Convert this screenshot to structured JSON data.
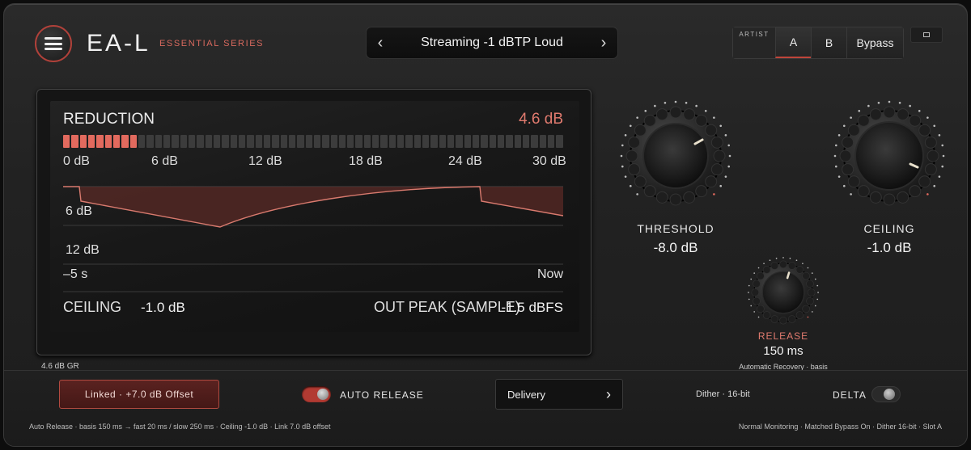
{
  "header": {
    "logo": "EA-L",
    "series": "ESSENTIAL SERIES",
    "preset_name": "Streaming -1 dBTP Loud",
    "prev_arrow": "‹",
    "next_arrow": "›",
    "artist_label": "ARTIST",
    "slot_a": "A",
    "slot_b": "B",
    "bypass": "Bypass"
  },
  "display": {
    "reduction_label": "REDUCTION",
    "reduction_value": "4.6 dB",
    "reduction_meter_fraction": 0.153,
    "scale_ticks": [
      "0 dB",
      "6 dB",
      "12 dB",
      "18 dB",
      "24 dB",
      "30 dB"
    ],
    "graph_label_6db": "6 dB",
    "graph_label_12db": "12 dB",
    "time_left": "–5 s",
    "time_right": "Now",
    "ceiling_label": "CEILING",
    "ceiling_value": "-1.0 dB",
    "out_peak_label": "OUT PEAK (SAMPLE)",
    "out_peak_value": "-1.5 dBFS",
    "gr_readout": "4.6 dB GR"
  },
  "knobs": {
    "threshold": {
      "label": "THRESHOLD",
      "value": "-8.0 dB"
    },
    "ceiling": {
      "label": "CEILING",
      "value": "-1.0 dB"
    },
    "release": {
      "label": "RELEASE",
      "value": "150 ms",
      "sub": "Automatic Recovery · basis"
    }
  },
  "bottom": {
    "linked_button": "Linked · +7.0 dB Offset",
    "auto_release_label": "AUTO RELEASE",
    "delivery_label": "Delivery",
    "delivery_arrow": "›",
    "dither": "Dither · 16-bit",
    "delta_label": "DELTA",
    "status_left": "Auto Release · basis 150 ms → fast 20 ms / slow 250 ms · Ceiling -1.0 dB · Link 7.0 dB offset",
    "status_right": "Normal Monitoring · Matched Bypass On · Dither 16-bit · Slot A"
  },
  "colors": {
    "accent": "#e26a5e",
    "accent_dark": "#b23a32"
  },
  "icons": {
    "menu": "hamburger-icon",
    "expand": "expand-icon"
  }
}
